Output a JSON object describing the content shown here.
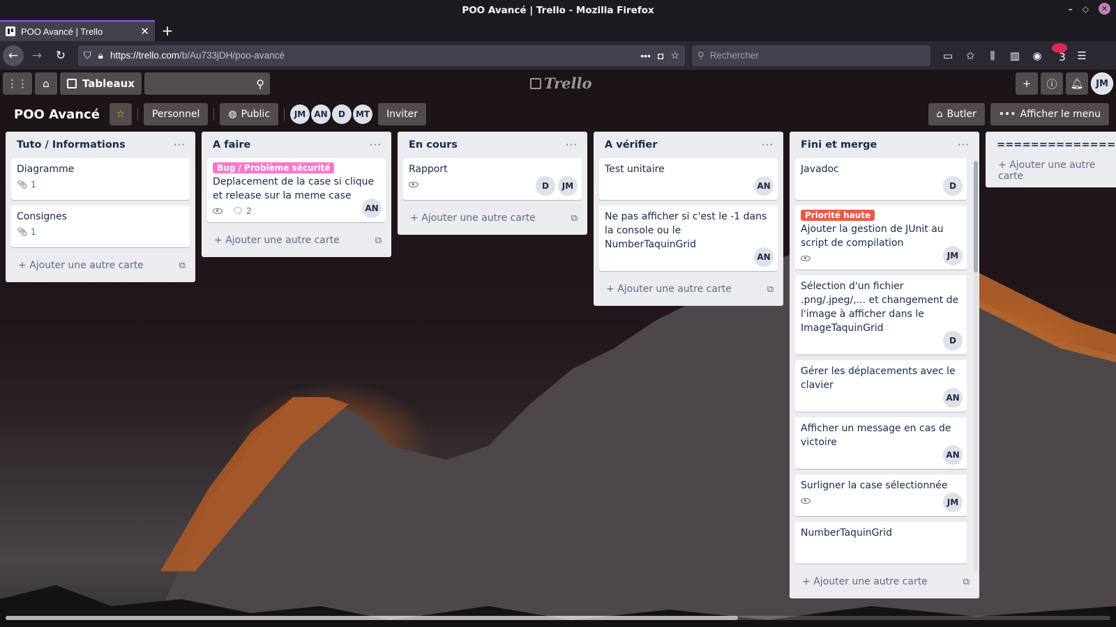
{
  "browser": {
    "window_title": "POO Avancé | Trello - Mozilla Firefox",
    "tab_title": "POO Avancé | Trello",
    "url_domain": "https://trello.com",
    "url_path": "/b/Au733jDH/poo-avancé",
    "search_placeholder": "Rechercher",
    "ext_badge": "3"
  },
  "appbar": {
    "boards_label": "Tableaux",
    "logo_text": "Trello",
    "user_initials": "JM"
  },
  "board": {
    "title": "POO Avancé",
    "team_label": "Personnel",
    "visibility_label": "Public",
    "members": [
      "JM",
      "AN",
      "D",
      "MT"
    ],
    "invite_label": "Inviter",
    "butler_label": "Butler",
    "menu_label": "Afficher le menu"
  },
  "lists": [
    {
      "title": "Tuto / Informations",
      "add_label": "Ajouter une autre carte"
    },
    {
      "title": "A faire",
      "add_label": "Ajouter une autre carte"
    },
    {
      "title": "En cours",
      "add_label": "Ajouter une autre carte"
    },
    {
      "title": "A vérifier",
      "add_label": "Ajouter une autre carte"
    },
    {
      "title": "Fini et merge",
      "add_label": "Ajouter une autre carte"
    },
    {
      "title": "===============",
      "add_label": "Ajouter une autre carte"
    }
  ],
  "cards": {
    "c1_1": {
      "title": "Diagramme",
      "attachments": "1"
    },
    "c1_2": {
      "title": "Consignes",
      "attachments": "1"
    },
    "c2_1": {
      "label": "Bug / Problème sécurité",
      "title": "Deplacement de la case si clique et release sur la meme case",
      "comments": "2",
      "member": "AN"
    },
    "c3_1": {
      "title": "Rapport",
      "members": [
        "D",
        "JM"
      ]
    },
    "c4_1": {
      "title": "Test unitaire",
      "member": "AN"
    },
    "c4_2": {
      "title": "Ne pas afficher si c'est le -1 dans la console ou le NumberTaquinGrid",
      "member": "AN"
    },
    "c5_1": {
      "title": "Javadoc",
      "member": "D"
    },
    "c5_2": {
      "label": "Priorité haute",
      "title": "Ajouter la gestion de JUnit au script de compilation",
      "member": "JM"
    },
    "c5_3": {
      "title": "Sélection d'un fichier .png/.jpeg/,... et changement de l'image à afficher dans le ImageTaquinGrid",
      "member": "D"
    },
    "c5_4": {
      "title": "Gérer les déplacements avec le clavier",
      "member": "AN"
    },
    "c5_5": {
      "title": "Afficher un message en cas de victoire",
      "member": "AN"
    },
    "c5_6": {
      "title": "Surligner la case sélectionnée",
      "member": "JM"
    },
    "c5_7": {
      "title": "NumberTaquinGrid"
    }
  },
  "colors": {
    "label_bug": "#ff78cb",
    "label_priority": "#eb5a46",
    "firefox_accent": "#9059ff"
  }
}
